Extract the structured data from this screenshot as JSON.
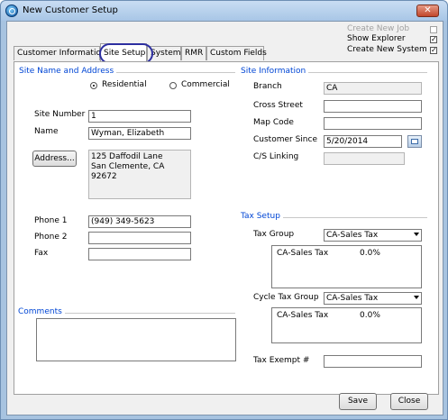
{
  "window": {
    "title": "New Customer Setup",
    "close_label": "✕"
  },
  "top_options": {
    "create_new_job": {
      "label": "Create New Job",
      "checked": false
    },
    "show_explorer": {
      "label": "Show Explorer",
      "checked": true
    },
    "create_new_system": {
      "label": "Create New System",
      "checked": true
    }
  },
  "tabs": [
    {
      "label": "Customer Information"
    },
    {
      "label": "Site Setup"
    },
    {
      "label": "System"
    },
    {
      "label": "RMR"
    },
    {
      "label": "Custom Fields"
    }
  ],
  "site_name_address": {
    "title": "Site Name and Address",
    "radio_residential": "Residential",
    "radio_commercial": "Commercial",
    "site_number_label": "Site Number",
    "site_number_value": "1",
    "name_label": "Name",
    "name_value": "Wyman, Elizabeth",
    "address_button": "Address...",
    "address_line1": "125 Daffodil Lane",
    "address_line2": "San Clemente, CA  92672",
    "phone1_label": "Phone 1",
    "phone1_value": "(949) 349-5623",
    "phone2_label": "Phone 2",
    "phone2_value": "",
    "fax_label": "Fax",
    "fax_value": ""
  },
  "comments": {
    "title": "Comments",
    "value": ""
  },
  "site_information": {
    "title": "Site Information",
    "branch_label": "Branch",
    "branch_value": "CA",
    "cross_street_label": "Cross Street",
    "cross_street_value": "",
    "map_code_label": "Map Code",
    "map_code_value": "",
    "customer_since_label": "Customer Since",
    "customer_since_value": "5/20/2014",
    "cs_linking_label": "C/S Linking",
    "cs_linking_value": ""
  },
  "tax_setup": {
    "title": "Tax Setup",
    "tax_group_label": "Tax Group",
    "tax_group_value": "CA-Sales Tax",
    "tax_group_list": [
      {
        "name": "CA-Sales Tax",
        "rate": "0.0%"
      }
    ],
    "cycle_tax_group_label": "Cycle Tax Group",
    "cycle_tax_group_value": "CA-Sales Tax",
    "cycle_tax_group_list": [
      {
        "name": "CA-Sales Tax",
        "rate": "0.0%"
      }
    ],
    "tax_exempt_label": "Tax Exempt #",
    "tax_exempt_value": ""
  },
  "buttons": {
    "save": "Save",
    "close": "Close"
  }
}
